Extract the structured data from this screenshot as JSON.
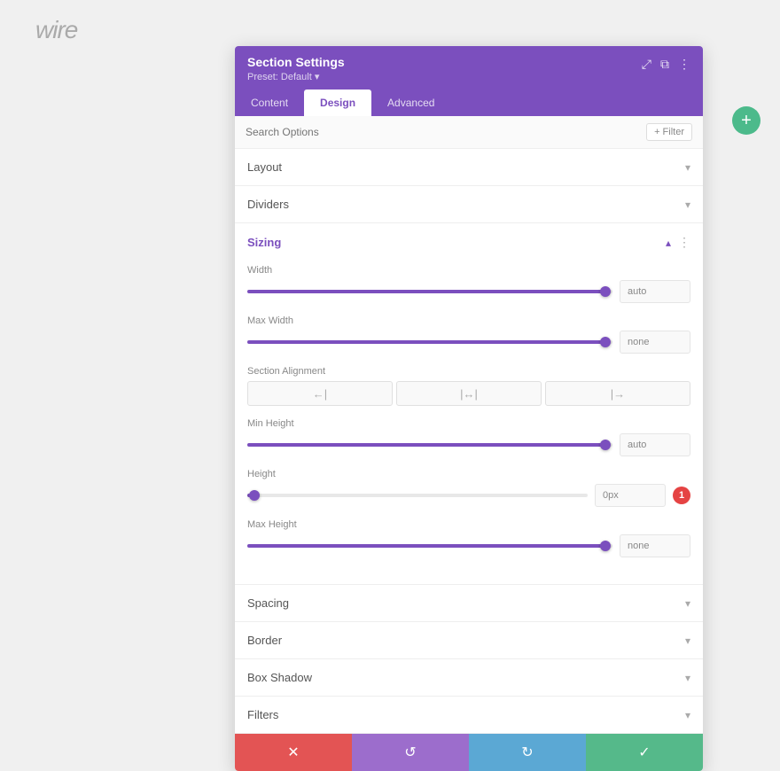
{
  "logo": {
    "text": "wire"
  },
  "add_fab": {
    "icon": "+"
  },
  "panel": {
    "header": {
      "title": "Section Settings",
      "preset": "Preset: Default ▾",
      "icons": [
        "⤢",
        "⧉",
        "⋮"
      ]
    },
    "tabs": [
      {
        "label": "Content",
        "active": false
      },
      {
        "label": "Design",
        "active": true
      },
      {
        "label": "Advanced",
        "active": false
      }
    ],
    "search_placeholder": "Search Options",
    "filter_label": "+ Filter",
    "sections": [
      {
        "id": "layout",
        "label": "Layout",
        "open": false
      },
      {
        "id": "dividers",
        "label": "Dividers",
        "open": false
      },
      {
        "id": "sizing",
        "label": "Sizing",
        "open": true
      },
      {
        "id": "spacing",
        "label": "Spacing",
        "open": false
      },
      {
        "id": "border",
        "label": "Border",
        "open": false
      },
      {
        "id": "box-shadow",
        "label": "Box Shadow",
        "open": false
      },
      {
        "id": "filters",
        "label": "Filters",
        "open": false
      }
    ],
    "sizing": {
      "width": {
        "label": "Width",
        "slider_pct": 98,
        "value": "auto"
      },
      "max_width": {
        "label": "Max Width",
        "slider_pct": 98,
        "value": "none"
      },
      "section_alignment": {
        "label": "Section Alignment",
        "options": [
          "←|",
          "|↔|",
          "|→"
        ]
      },
      "min_height": {
        "label": "Min Height",
        "slider_pct": 98,
        "value": "auto"
      },
      "height": {
        "label": "Height",
        "slider_pct": 2,
        "value": "0px",
        "has_error": true,
        "error_count": 1
      },
      "max_height": {
        "label": "Max Height",
        "slider_pct": 98,
        "value": "none"
      }
    },
    "actions": {
      "cancel": "✕",
      "undo": "↺",
      "redo": "↻",
      "save": "✓"
    }
  }
}
